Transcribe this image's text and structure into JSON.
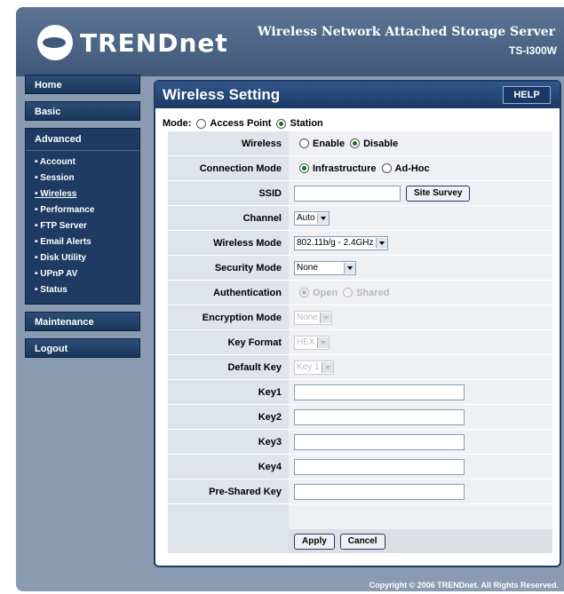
{
  "header": {
    "brand": "TRENDnet",
    "product_title": "Wireless Network Attached Storage Server",
    "model": "TS-I300W"
  },
  "nav": {
    "home": "Home",
    "basic": "Basic",
    "advanced": "Advanced",
    "advanced_items": [
      "• Account",
      "• Session",
      "• Wireless",
      "• Performance",
      "• FTP Server",
      "• Email Alerts",
      "• Disk Utility",
      "• UPnP AV",
      "• Status"
    ],
    "maintenance": "Maintenance",
    "logout": "Logout"
  },
  "panel": {
    "title": "Wireless Setting",
    "help": "HELP",
    "mode_label": "Mode:",
    "mode_ap": "Access Point",
    "mode_station": "Station"
  },
  "form": {
    "wireless_label": "Wireless",
    "wireless_enable": "Enable",
    "wireless_disable": "Disable",
    "conn_label": "Connection Mode",
    "conn_infra": "Infrastructure",
    "conn_adhoc": "Ad-Hoc",
    "ssid_label": "SSID",
    "ssid_value": "",
    "site_survey": "Site Survey",
    "channel_label": "Channel",
    "channel_value": "Auto",
    "wmode_label": "Wireless Mode",
    "wmode_value": "802.11b/g - 2.4GHz",
    "security_label": "Security Mode",
    "security_value": "None",
    "auth_label": "Authentication",
    "auth_open": "Open",
    "auth_shared": "Shared",
    "enc_label": "Encryption Mode",
    "enc_value": "None",
    "keyformat_label": "Key Format",
    "keyformat_value": "HEX",
    "defkey_label": "Default Key",
    "defkey_value": "Key 1",
    "key1_label": "Key1",
    "key2_label": "Key2",
    "key3_label": "Key3",
    "key4_label": "Key4",
    "psk_label": "Pre-Shared Key",
    "apply": "Apply",
    "cancel": "Cancel"
  },
  "footer": {
    "copyright": "Copyright © 2006 TRENDnet. All Rights Reserved."
  }
}
